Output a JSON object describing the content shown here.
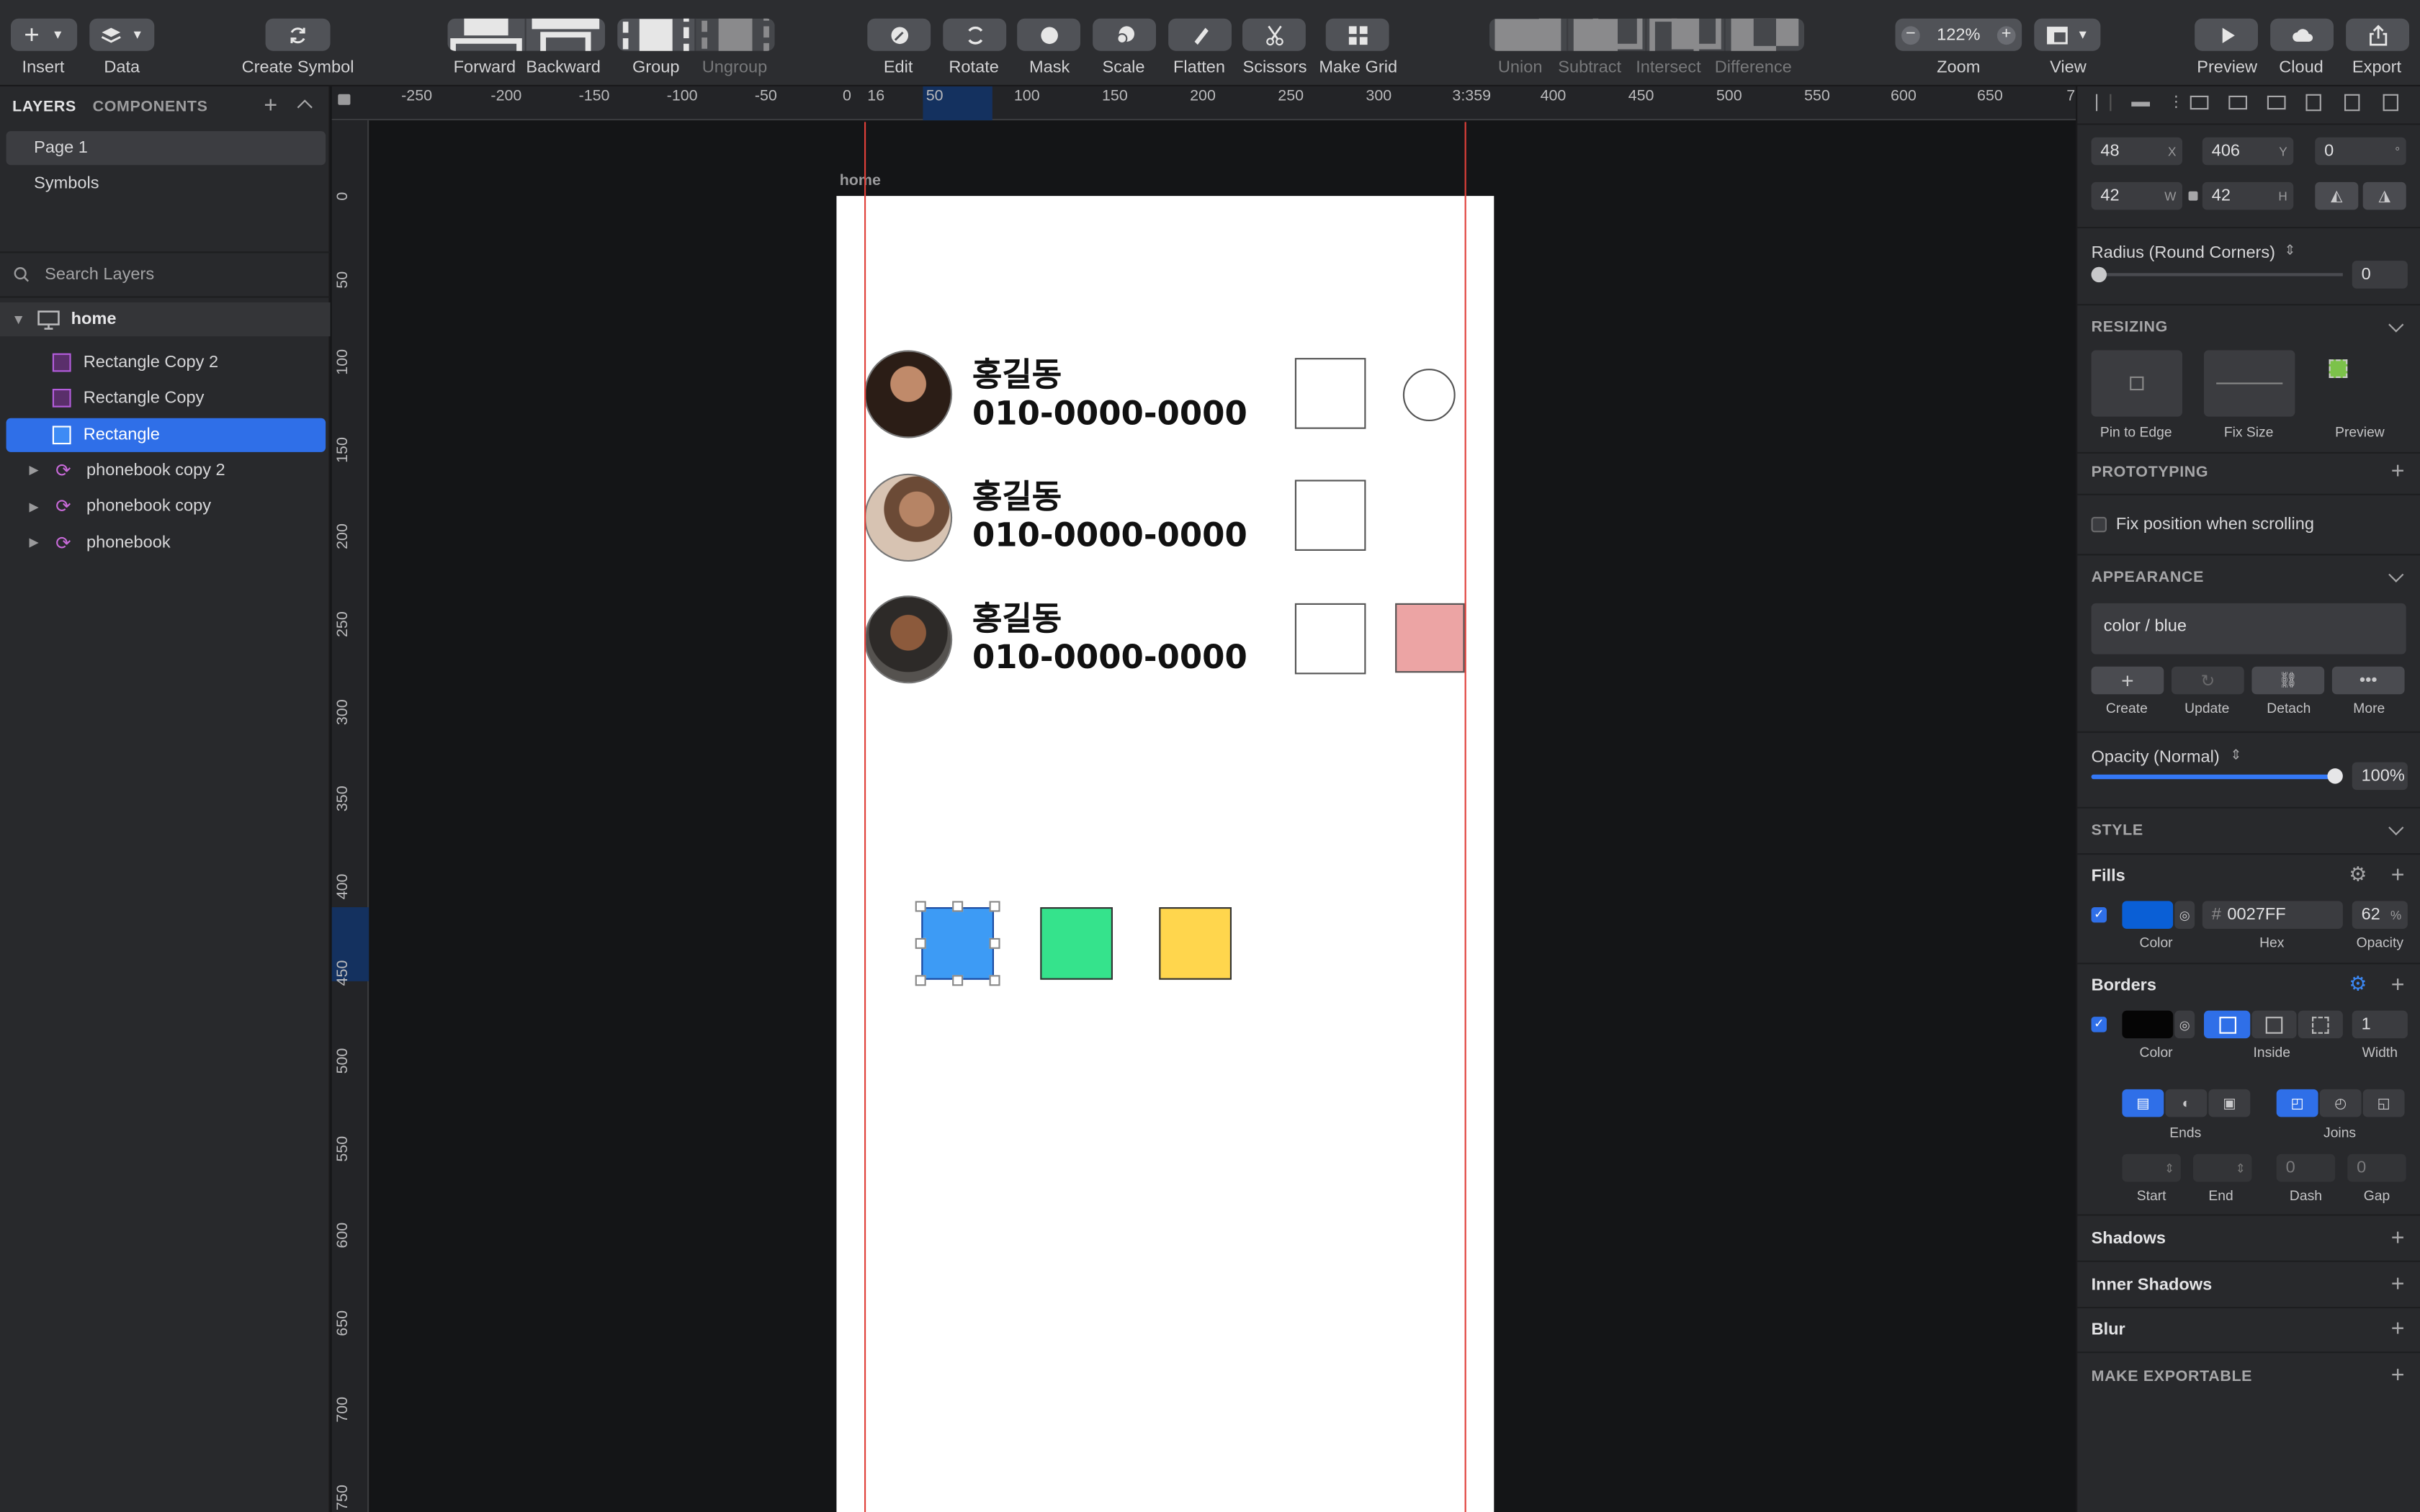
{
  "toolbar": {
    "insert": "Insert",
    "data": "Data",
    "create_symbol": "Create Symbol",
    "forward": "Forward",
    "backward": "Backward",
    "group": "Group",
    "ungroup": "Ungroup",
    "edit": "Edit",
    "rotate": "Rotate",
    "mask": "Mask",
    "scale": "Scale",
    "flatten": "Flatten",
    "scissors": "Scissors",
    "make_grid": "Make Grid",
    "union": "Union",
    "subtract": "Subtract",
    "intersect": "Intersect",
    "difference": "Difference",
    "zoom_value": "122%",
    "zoom_label": "Zoom",
    "view": "View",
    "preview": "Preview",
    "cloud": "Cloud",
    "export": "Export"
  },
  "layers_panel": {
    "tab_layers": "LAYERS",
    "tab_components": "COMPONENTS",
    "pages": [
      "Page 1",
      "Symbols"
    ],
    "search_placeholder": "Search Layers",
    "artboard": "home",
    "layers": [
      {
        "name": "Rectangle Copy 2",
        "kind": "rect",
        "selected": false
      },
      {
        "name": "Rectangle Copy",
        "kind": "rect",
        "selected": false
      },
      {
        "name": "Rectangle",
        "kind": "rect",
        "selected": true
      },
      {
        "name": "phonebook copy 2",
        "kind": "symbol",
        "selected": false
      },
      {
        "name": "phonebook copy",
        "kind": "symbol",
        "selected": false
      },
      {
        "name": "phonebook",
        "kind": "symbol",
        "selected": false
      }
    ]
  },
  "ruler": {
    "top_labels": [
      "-250",
      "-200",
      "-150",
      "-100",
      "-50",
      "0",
      "16",
      "50",
      "100",
      "150",
      "200",
      "250",
      "300",
      "3:359",
      "400",
      "450",
      "500",
      "550",
      "600",
      "650",
      "7"
    ],
    "left_labels": [
      "0",
      "50",
      "100",
      "150",
      "200",
      "250",
      "300",
      "350",
      "400",
      "450",
      "500",
      "550",
      "600",
      "650",
      "700",
      "750"
    ]
  },
  "canvas": {
    "artboard_label": "home",
    "contacts": [
      {
        "name": "홍길동",
        "phone": "010-0000-0000"
      },
      {
        "name": "홍길동",
        "phone": "010-0000-0000"
      },
      {
        "name": "홍길동",
        "phone": "010-0000-0000"
      }
    ],
    "colors": {
      "blue": "#3d9bf5",
      "green": "#35e38c",
      "yellow": "#ffd64d",
      "pink": "#eca4a4"
    }
  },
  "inspector": {
    "x": "48",
    "x_label": "X",
    "y": "406",
    "y_label": "Y",
    "rotation": "0",
    "rotation_unit": "°",
    "w": "42",
    "w_label": "W",
    "h": "42",
    "h_label": "H",
    "radius_label": "Radius (Round Corners)",
    "radius_value": "0",
    "resizing_title": "RESIZING",
    "pin_to_edge": "Pin to Edge",
    "fix_size": "Fix Size",
    "preview": "Preview",
    "prototyping_title": "PROTOTYPING",
    "fix_position": "Fix position when scrolling",
    "appearance_title": "APPEARANCE",
    "appearance_style": "color / blue",
    "create": "Create",
    "update": "Update",
    "detach": "Detach",
    "more": "More",
    "opacity_label": "Opacity (Normal)",
    "opacity_value": "100%",
    "style_title": "STYLE",
    "fills": "Fills",
    "fill_hex": "0027FF",
    "fill_opacity": "62",
    "fill_opacity_unit": "%",
    "fill_color": "#0a5fd6",
    "color_label": "Color",
    "hex_label": "Hex",
    "opacity_short": "Opacity",
    "borders": "Borders",
    "border_position": "Inside",
    "border_width": "1",
    "width_label": "Width",
    "ends_label": "Ends",
    "joins_label": "Joins",
    "start_label": "Start",
    "end_label": "End",
    "dash_label": "Dash",
    "gap_label": "Gap",
    "dash_value": "0",
    "gap_value": "0",
    "shadows": "Shadows",
    "inner_shadows": "Inner Shadows",
    "blur": "Blur",
    "make_exportable": "MAKE EXPORTABLE"
  }
}
